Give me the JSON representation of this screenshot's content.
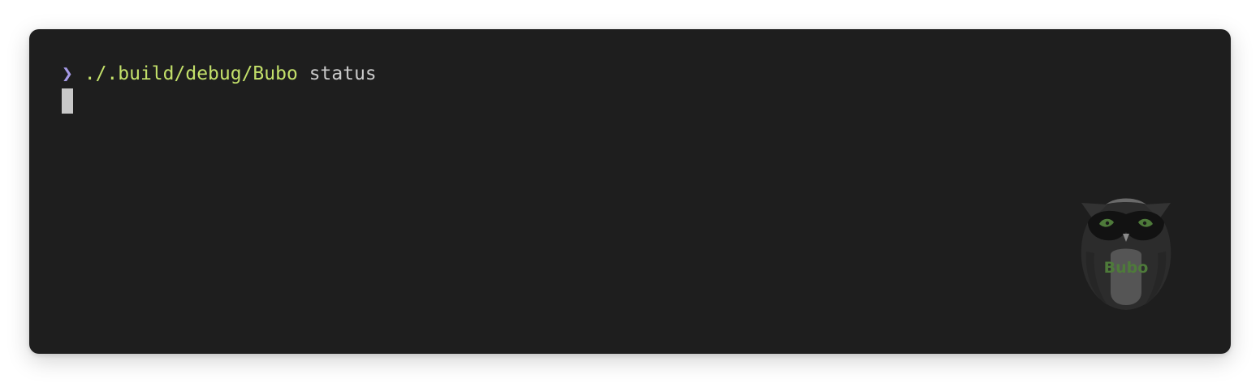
{
  "terminal": {
    "prompt_symbol": "❯",
    "command": "./.build/debug/Bubo",
    "argument": "status"
  },
  "watermark": {
    "label": "Bubo",
    "icon": "owl-icon"
  },
  "colors": {
    "background": "#1e1e1e",
    "prompt": "#a59ae6",
    "command": "#c3e06a",
    "argument": "#c9c9c9",
    "cursor": "#c8c8c8",
    "owl_accent": "#4e7a3a"
  }
}
